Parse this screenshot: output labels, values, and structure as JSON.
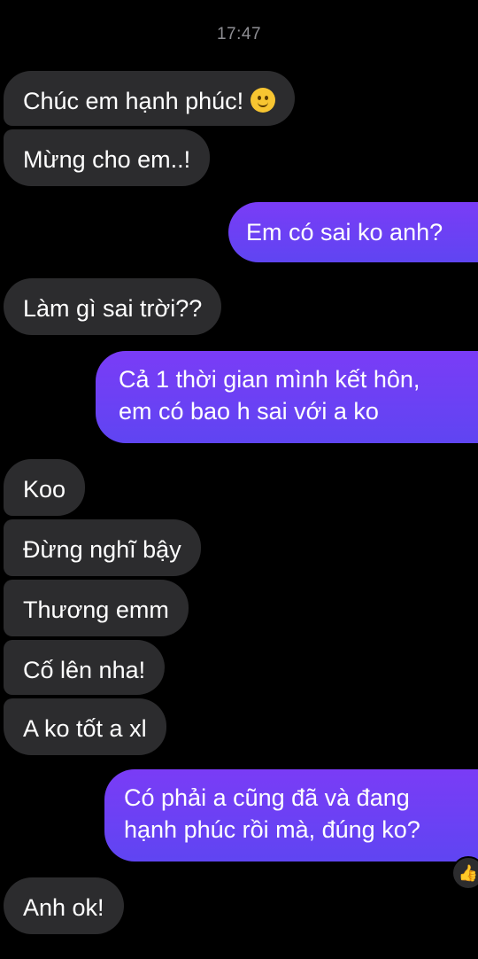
{
  "status": {
    "time": "17:47"
  },
  "messages": [
    {
      "dir": "in",
      "text": "Chúc em hạnh phúc!",
      "emoji": "slightly-smiling-face-icon"
    },
    {
      "dir": "in",
      "text": "Mừng cho em..!"
    },
    {
      "dir": "out",
      "text": "Em có sai ko anh?"
    },
    {
      "dir": "in",
      "text": "Làm gì sai trời??"
    },
    {
      "dir": "out",
      "lines": [
        "Cả 1 thời gian mình kết hôn,",
        "em có bao h sai với a ko"
      ]
    },
    {
      "dir": "in",
      "text": "Koo"
    },
    {
      "dir": "in",
      "text": "Đừng nghĩ bậy"
    },
    {
      "dir": "in",
      "text": "Thương emm"
    },
    {
      "dir": "in",
      "text": "Cố lên nha!"
    },
    {
      "dir": "in",
      "text": "A ko tốt a xl"
    },
    {
      "dir": "out",
      "lines": [
        "Có phải a cũng đã và đang",
        "hạnh phúc rồi mà, đúng ko?"
      ],
      "reaction": "thumbs-up-icon"
    },
    {
      "dir": "in",
      "text": "Anh ok!"
    }
  ],
  "colors": {
    "background": "#000000",
    "incoming_bubble": "#2c2c2e",
    "outgoing_bubble": "#6f3ff5",
    "timestamp": "#8e8e93"
  }
}
